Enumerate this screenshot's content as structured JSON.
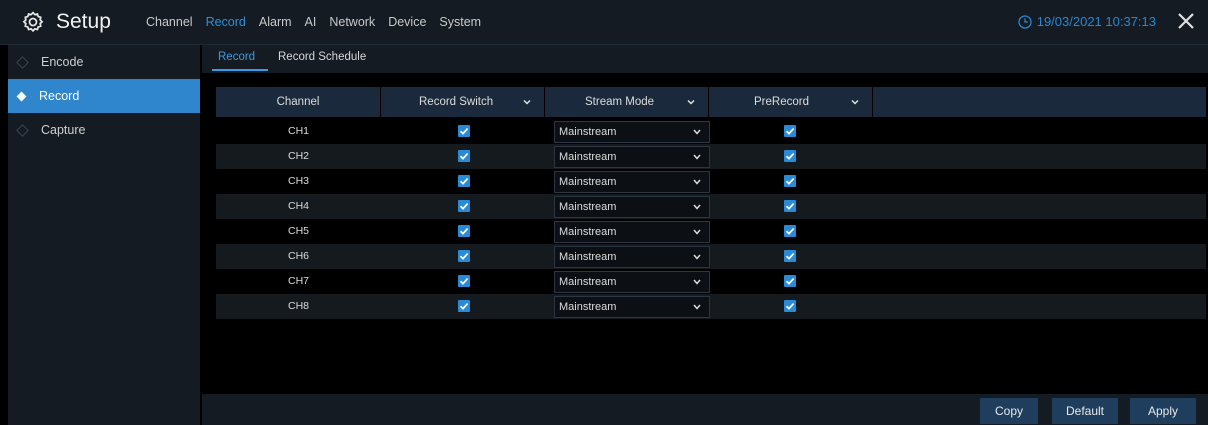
{
  "app": {
    "title": "Setup",
    "icon": "gear-icon"
  },
  "topnav": {
    "items": [
      {
        "label": "Channel"
      },
      {
        "label": "Record",
        "active": true
      },
      {
        "label": "Alarm"
      },
      {
        "label": "AI"
      },
      {
        "label": "Network"
      },
      {
        "label": "Device"
      },
      {
        "label": "System"
      }
    ]
  },
  "clock": {
    "datetime": "19/03/2021 10:37:13",
    "icon": "clock-icon"
  },
  "sidebar": {
    "items": [
      {
        "label": "Encode"
      },
      {
        "label": "Record",
        "active": true
      },
      {
        "label": "Capture"
      }
    ]
  },
  "subtabs": [
    {
      "label": "Record",
      "active": true
    },
    {
      "label": "Record Schedule"
    }
  ],
  "table": {
    "headers": {
      "channel": "Channel",
      "record_switch": "Record Switch",
      "stream_mode": "Stream Mode",
      "prerecord": "PreRecord"
    },
    "rows": [
      {
        "channel": "CH1",
        "record_switch": true,
        "stream_mode": "Mainstream",
        "prerecord": true
      },
      {
        "channel": "CH2",
        "record_switch": true,
        "stream_mode": "Mainstream",
        "prerecord": true
      },
      {
        "channel": "CH3",
        "record_switch": true,
        "stream_mode": "Mainstream",
        "prerecord": true
      },
      {
        "channel": "CH4",
        "record_switch": true,
        "stream_mode": "Mainstream",
        "prerecord": true
      },
      {
        "channel": "CH5",
        "record_switch": true,
        "stream_mode": "Mainstream",
        "prerecord": true
      },
      {
        "channel": "CH6",
        "record_switch": true,
        "stream_mode": "Mainstream",
        "prerecord": true
      },
      {
        "channel": "CH7",
        "record_switch": true,
        "stream_mode": "Mainstream",
        "prerecord": true
      },
      {
        "channel": "CH8",
        "record_switch": true,
        "stream_mode": "Mainstream",
        "prerecord": true
      }
    ]
  },
  "buttons": {
    "copy": "Copy",
    "default": "Default",
    "apply": "Apply"
  },
  "colors": {
    "accent": "#2f86cc",
    "topbar": "#141b22",
    "header_row": "#1a2a3c"
  }
}
